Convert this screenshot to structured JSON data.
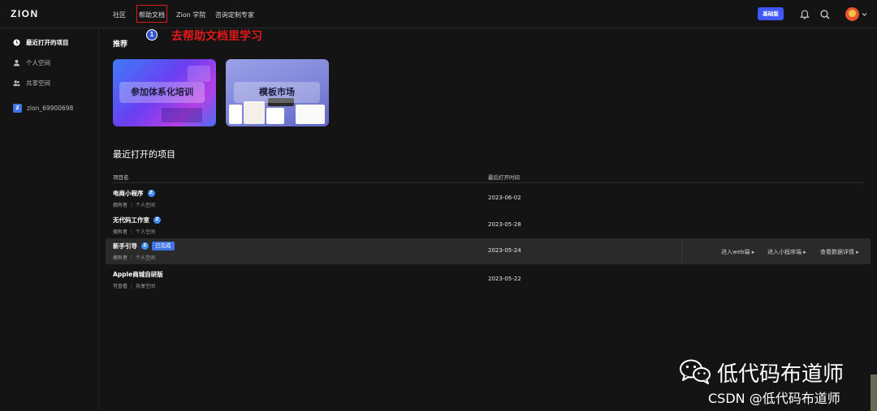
{
  "app": {
    "logo": "ZION"
  },
  "nav": {
    "community": "社区",
    "help_docs": "帮助文档",
    "academy": "Zion 学院",
    "consulting": "咨询定制专家"
  },
  "plan_badge": "基础版",
  "annotation": {
    "number": "1",
    "text": "去帮助文档里学习",
    "color": "#e0191b"
  },
  "sidebar": {
    "items": [
      {
        "label": "最近打开的项目",
        "icon": "clock-icon",
        "active": true
      },
      {
        "label": "个人空间",
        "icon": "user-icon",
        "active": false
      },
      {
        "label": "共享空间",
        "icon": "users-icon",
        "active": false
      }
    ],
    "workspace": {
      "badge": "Z",
      "label": "zion_69900698"
    }
  },
  "recommend": {
    "title": "推荐",
    "cards": [
      {
        "label": "参加体系化培训"
      },
      {
        "label": "模板市场"
      }
    ]
  },
  "recent": {
    "title": "最近打开的项目",
    "columns": {
      "name": "项目名",
      "last_opened": "最后打开时间"
    },
    "rows": [
      {
        "name": "电商小程序",
        "badge": "Z",
        "status": "",
        "role": "拥有者",
        "space": "个人空间",
        "date": "2023-06-02"
      },
      {
        "name": "无代码工作室",
        "badge": "Z",
        "status": "",
        "role": "拥有者",
        "space": "个人空间",
        "date": "2023-05-28"
      },
      {
        "name": "新手引导",
        "badge": "Z",
        "status": "已完成",
        "role": "拥有者",
        "space": "个人空间",
        "date": "2023-05-24",
        "actions": [
          "进入web端 ▸",
          "进入小程序端 ▸",
          "查看数据详情 ▸"
        ]
      },
      {
        "name": "Apple商城自研版",
        "badge": "",
        "status": "",
        "role": "可查看",
        "space": "共享空间",
        "date": "2023-05-22"
      }
    ]
  },
  "watermark": {
    "main": "低代码布道师",
    "csdn": "CSDN @低代码布道师"
  },
  "colors": {
    "background": "#141414",
    "accent": "#3f58ff",
    "badge_blue": "#3e74e6",
    "annotation_red": "#e0191b"
  }
}
